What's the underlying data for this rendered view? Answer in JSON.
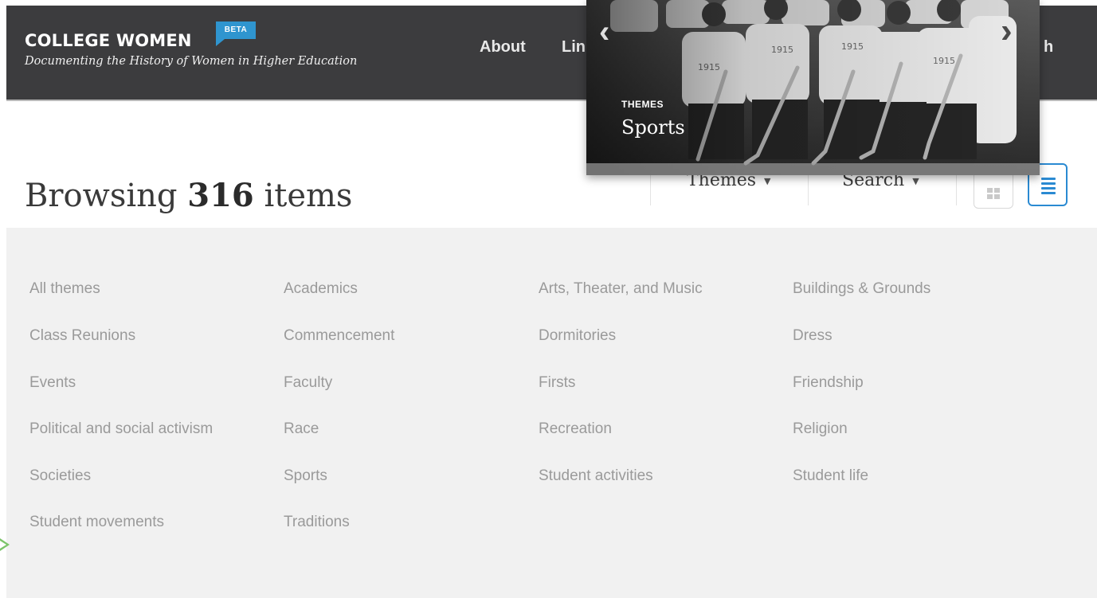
{
  "header": {
    "brand": "COLLEGE WOMEN",
    "badge": "BETA",
    "tagline": "Documenting the History of Women in Higher Education",
    "nav": {
      "about": "About",
      "links_partial": "Lin",
      "trailing_partial": "h"
    }
  },
  "toolbar": {
    "heading_prefix": "Browsing ",
    "item_count": "316",
    "heading_suffix": " items",
    "themes_dropdown": "Themes",
    "search_dropdown": "Search",
    "views": [
      "grid-view-icon",
      "list-view-icon"
    ]
  },
  "themes": [
    "All themes",
    "Academics",
    "Arts, Theater, and Music",
    "Buildings & Grounds",
    "Class Reunions",
    "Commencement",
    "Dormitories",
    "Dress",
    "Events",
    "Faculty",
    "Firsts",
    "Friendship",
    "Political and social activism",
    "Race",
    "Recreation",
    "Religion",
    "Societies",
    "Sports",
    "Student activities",
    "Student life",
    "Student movements",
    "Traditions"
  ],
  "feature": {
    "kicker": "THEMES",
    "caption": "Sports",
    "jersey_text": "1915",
    "prev_icon": "chevron-left-icon",
    "next_icon": "chevron-right-icon"
  },
  "colors": {
    "header_bg": "#3c3c3e",
    "accent": "#2a8ad2",
    "badge": "#2f95cf",
    "panel_bg": "#f1f1f1",
    "theme_text": "#9a9a9a"
  }
}
